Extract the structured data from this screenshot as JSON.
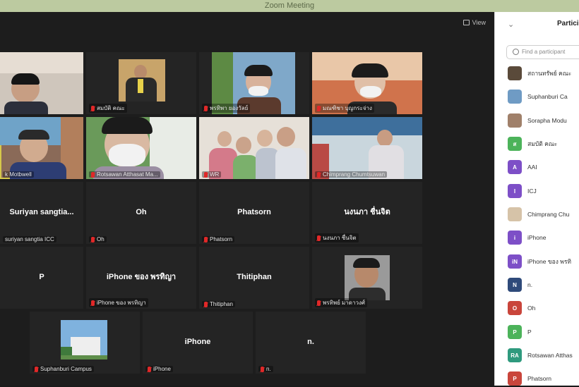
{
  "window": {
    "title": "Zoom Meeting"
  },
  "toolbar": {
    "view_label": "View"
  },
  "tiles": [
    {
      "name": ""
    },
    {
      "name": "สมบัติ คณะ"
    },
    {
      "name": "พรทิพา ยองวัลย์"
    },
    {
      "name": "มณฑิชา บุญกระจ่าง"
    },
    {
      "name": "k Motbwell"
    },
    {
      "name": "Rotsawan Atthasat Ma..."
    },
    {
      "name": "WR"
    },
    {
      "name": "Chimprang Chumtsuwan"
    },
    {
      "center": "Suriyan  sangtia...",
      "name": "suriyan sangtia ICC"
    },
    {
      "center": "Oh",
      "name": "Oh"
    },
    {
      "center": "Phatsorn",
      "name": "Phatsorn"
    },
    {
      "center": "นงนภา ชื่นจิต",
      "name": "นงนภา ชื่นจิต"
    },
    {
      "center": "P",
      "name": ""
    },
    {
      "center": "iPhone ของ พรทิญา",
      "name": "iPhone ของ พรทิญา"
    },
    {
      "center": "Thitiphan",
      "name": "Thitiphan"
    },
    {
      "name": "พรทิพย์ มาดาวงศ์"
    },
    {
      "name": "Suphanburi Campus"
    },
    {
      "center": "iPhone",
      "name": "iPhone"
    },
    {
      "center": "n.",
      "name": "n."
    }
  ],
  "panel": {
    "title": "Partici",
    "search_placeholder": "Find a participant",
    "participants": [
      {
        "name": "สถานทรัพย์ คณะ",
        "avatar": ""
      },
      {
        "name": "Suphanburi Ca",
        "avatar": ""
      },
      {
        "name": "Sorapha Modu",
        "avatar": ""
      },
      {
        "name": "สมบัติ คณะ",
        "avatar": "ส",
        "color": "#4cb35a"
      },
      {
        "name": "AAI",
        "avatar": "A",
        "color": "#7d4fc7"
      },
      {
        "name": "ICJ",
        "avatar": "I",
        "color": "#7d4fc7"
      },
      {
        "name": "Chimprang Chu",
        "avatar": ""
      },
      {
        "name": "iPhone",
        "avatar": "i",
        "color": "#7d4fc7"
      },
      {
        "name": "iPhone ของ พรทิ",
        "avatar": "iN",
        "color": "#7d4fc7"
      },
      {
        "name": "n.",
        "avatar": "N",
        "color": "#2f4a7a"
      },
      {
        "name": "Oh",
        "avatar": "O",
        "color": "#c9453b"
      },
      {
        "name": "P",
        "avatar": "P",
        "color": "#4cb35a"
      },
      {
        "name": "Rotsawan Atthas",
        "avatar": "RA",
        "color": "#2f9a7e"
      },
      {
        "name": "Phatsorn",
        "avatar": "P",
        "color": "#c9453b"
      }
    ]
  }
}
